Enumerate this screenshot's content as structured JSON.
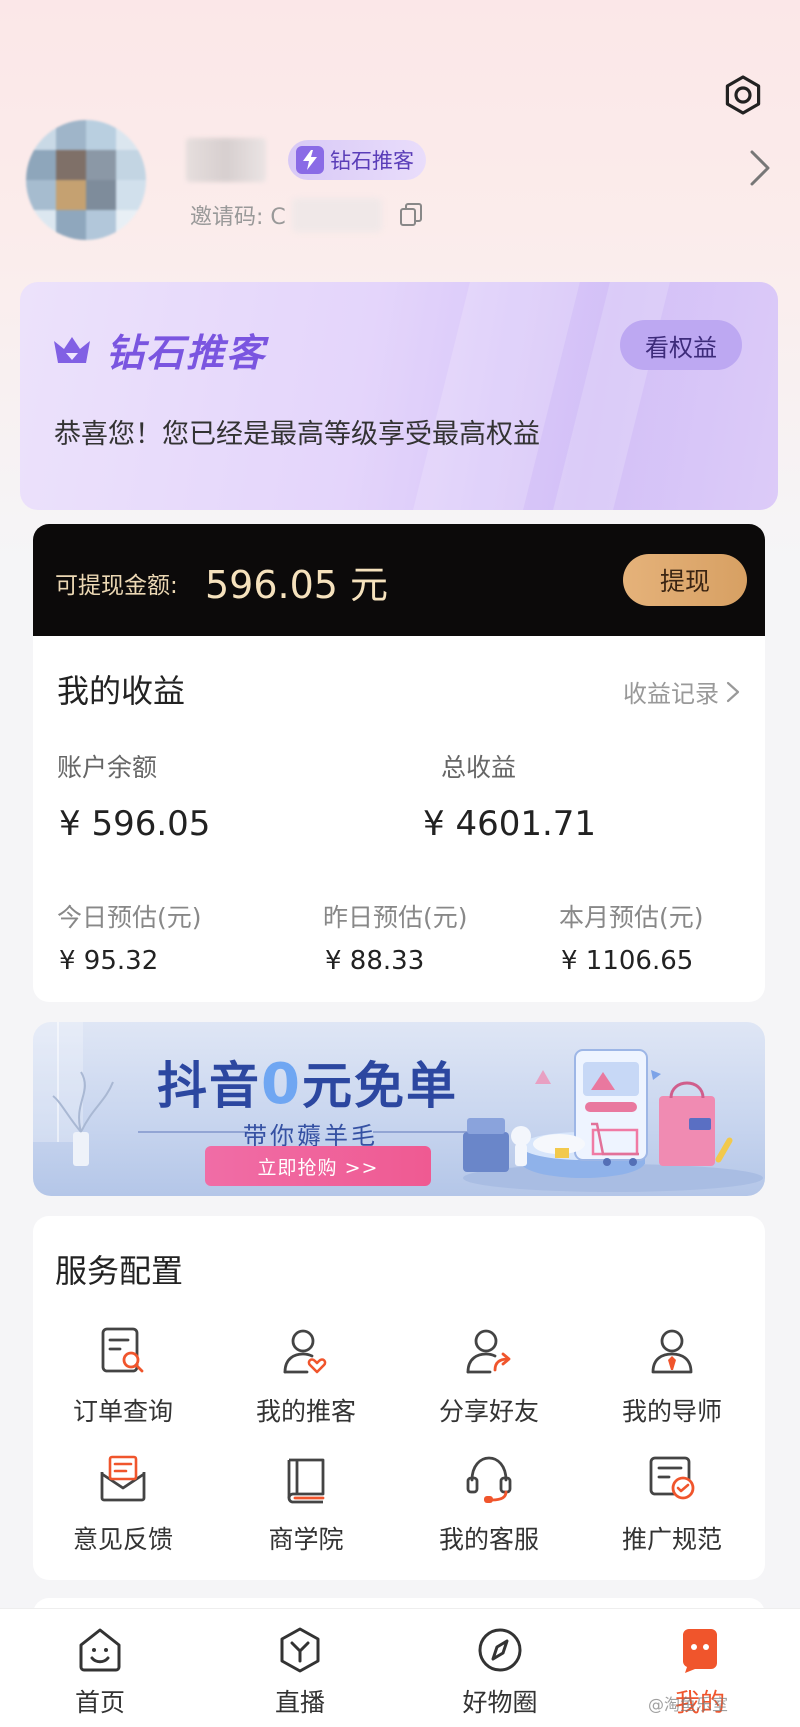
{
  "profile": {
    "badge": "钻石推客",
    "invite_label": "邀请码: C"
  },
  "diamond": {
    "title": "钻石推客",
    "rights_button": "看权益",
    "desc": "恭喜您！您已经是最高等级享受最高权益"
  },
  "withdraw": {
    "label": "可提现金额:",
    "amount": "596.05 元",
    "button": "提现"
  },
  "earnings": {
    "title": "我的收益",
    "record_link": "收益记录",
    "balance_label": "账户余额",
    "balance_value": "¥ 596.05",
    "total_label": "总收益",
    "total_value": "¥ 4601.71",
    "today_label": "今日预估(元)",
    "today_value": "¥ 95.32",
    "yesterday_label": "昨日预估(元)",
    "yesterday_value": "¥ 88.33",
    "month_label": "本月预估(元)",
    "month_value": "¥ 1106.65"
  },
  "banner": {
    "title_pre": "抖音",
    "title_zero": "0",
    "title_post": "元免单",
    "subtitle": "带你薅羊毛",
    "button": "立即抢购 >>"
  },
  "services": {
    "title": "服务配置",
    "items": [
      {
        "label": "订单查询",
        "icon": "order-search-icon"
      },
      {
        "label": "我的推客",
        "icon": "my-promoter-icon"
      },
      {
        "label": "分享好友",
        "icon": "share-friend-icon"
      },
      {
        "label": "我的导师",
        "icon": "mentor-icon"
      },
      {
        "label": "意见反馈",
        "icon": "feedback-icon"
      },
      {
        "label": "商学院",
        "icon": "academy-icon"
      },
      {
        "label": "我的客服",
        "icon": "customer-service-icon"
      },
      {
        "label": "推广规范",
        "icon": "promotion-rules-icon"
      }
    ]
  },
  "tabs": [
    {
      "label": "首页",
      "icon": "home-icon"
    },
    {
      "label": "直播",
      "icon": "live-icon"
    },
    {
      "label": "好物圈",
      "icon": "discover-icon"
    },
    {
      "label": "我的",
      "icon": "mine-icon",
      "active": true
    }
  ],
  "watermark": "@淘鱼乐室",
  "colors": {
    "accent": "#f0552c",
    "diamond_purple": "#7a55e0",
    "gold": "#dba869"
  }
}
